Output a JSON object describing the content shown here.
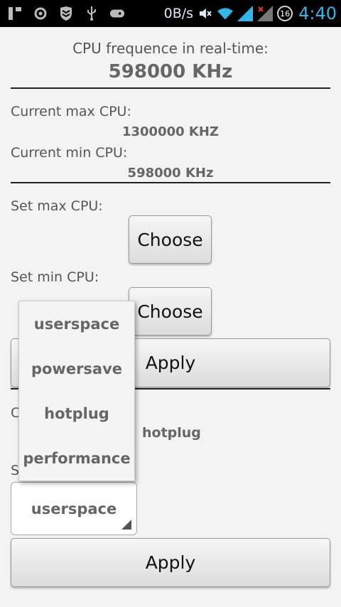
{
  "status_bar": {
    "network": "0B/s",
    "notification_count": "16",
    "time": "4:40"
  },
  "realtime": {
    "label": "CPU frequence in real-time:",
    "value": "598000 KHz"
  },
  "current": {
    "max_label": "Current max CPU:",
    "max_value": "1300000 KHZ",
    "min_label": "Current min CPU:",
    "min_value": "598000 KHz"
  },
  "set_max": {
    "label": "Set max CPU:",
    "button": "Choose"
  },
  "set_min": {
    "label": "Set min CPU:",
    "button": "Choose"
  },
  "apply_freq": {
    "button": "Apply"
  },
  "governor": {
    "current_label_partial": "C",
    "current_value": "hotplug",
    "set_label_partial": "S",
    "selected": "userspace",
    "apply_button": "Apply"
  },
  "dropdown": {
    "options": [
      "userspace",
      "powersave",
      "hotplug",
      "performance"
    ]
  }
}
